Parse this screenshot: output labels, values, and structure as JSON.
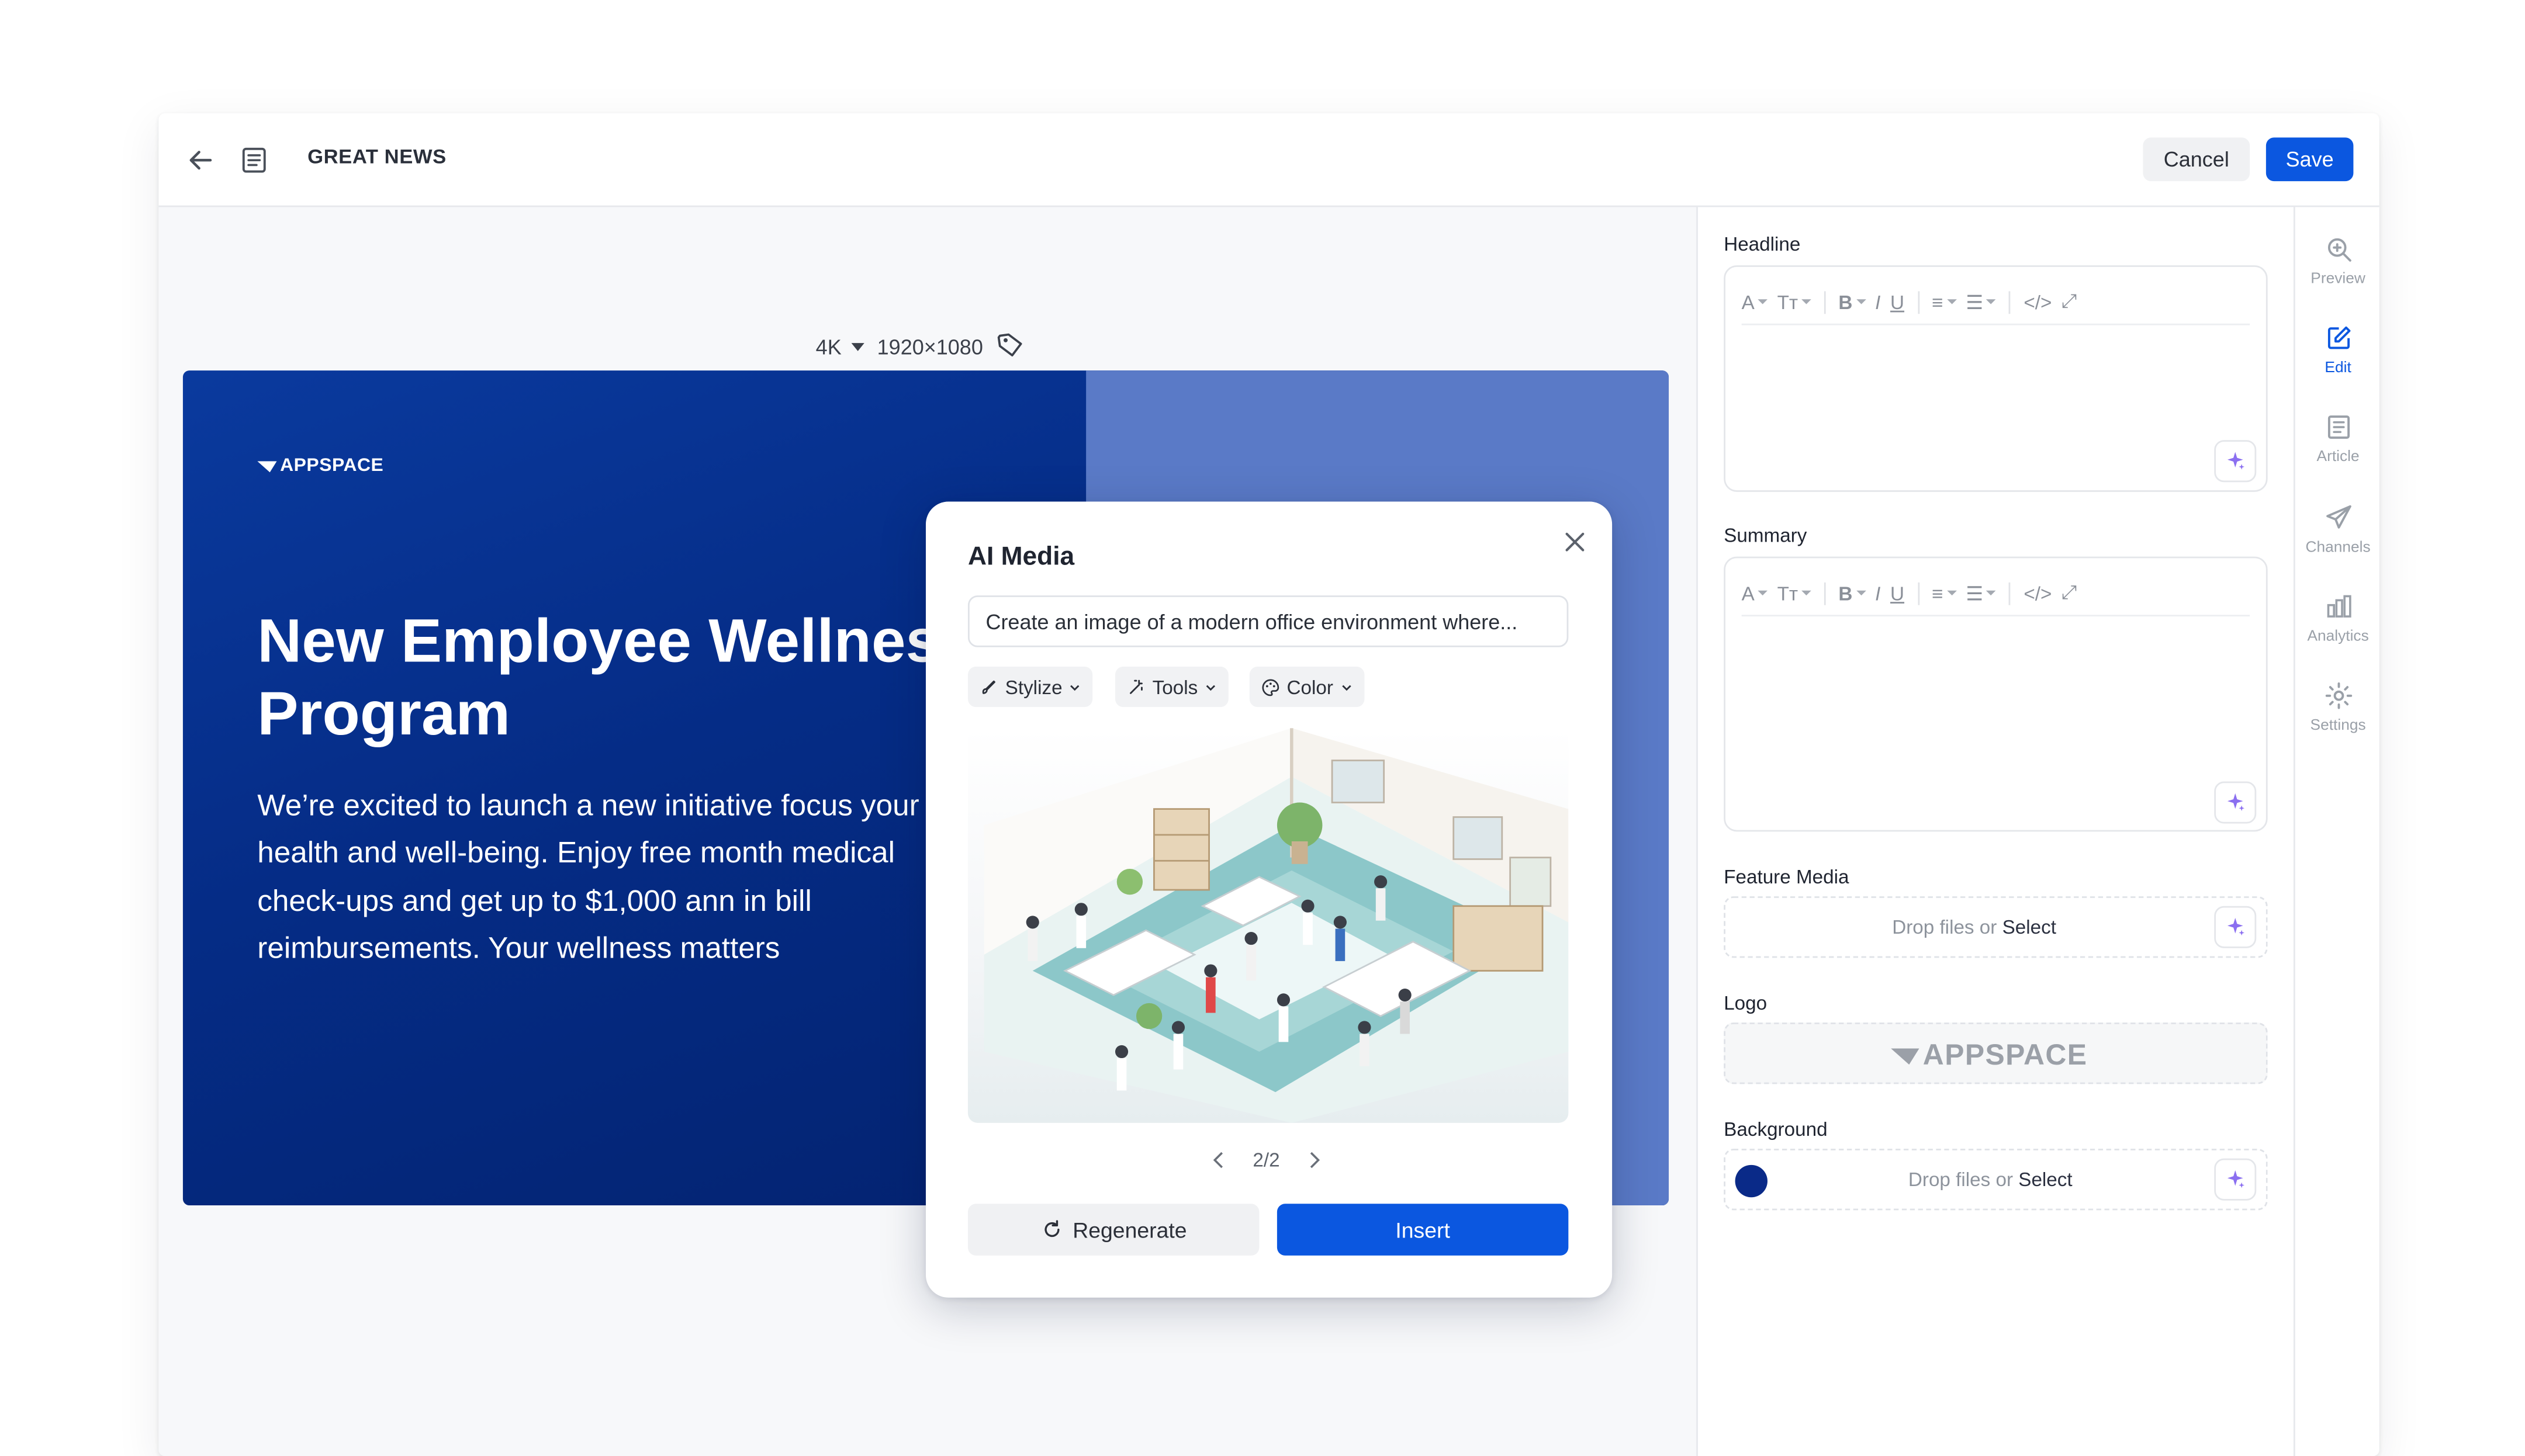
{
  "topbar": {
    "title": "GREAT NEWS",
    "cancel_label": "Cancel",
    "save_label": "Save"
  },
  "canvas": {
    "resolution_label": "4K",
    "dimensions": "1920×1080",
    "slide": {
      "brand": "APPSPACE",
      "title": "New Employee Wellness Program",
      "body": "We’re excited to launch a new initiative focus your health and well-being. Enjoy free month medical check-ups and get up to $1,000 ann in bill reimbursements. Your wellness matters"
    }
  },
  "ai_media": {
    "title": "AI Media",
    "prompt_value": "Create an image of a modern office environment where...",
    "chips": [
      "Stylize",
      "Tools",
      "Color"
    ],
    "pager": "2/2",
    "regenerate_label": "Regenerate",
    "insert_label": "Insert"
  },
  "panel": {
    "headline_label": "Headline",
    "summary_label": "Summary",
    "feature_media_label": "Feature Media",
    "logo_label": "Logo",
    "logo_text": "APPSPACE",
    "background_label": "Background",
    "drop_text": "Drop files or",
    "select_text": "Select",
    "background_color": "#0a2a88"
  },
  "rail": {
    "items": [
      "Preview",
      "Edit",
      "Article",
      "Channels",
      "Analytics",
      "Settings"
    ],
    "active": "Edit"
  },
  "colors": {
    "accent": "#0b57e0",
    "slide_primary": "#052c86",
    "slide_secondary": "#5a7ac7"
  }
}
